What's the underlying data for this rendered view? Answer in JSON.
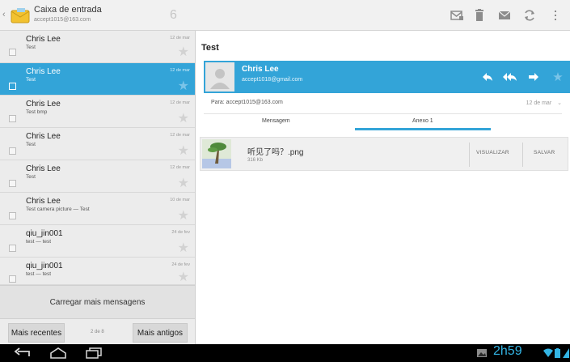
{
  "header": {
    "back_glyph": "‹",
    "inbox_title": "Caixa de entrada",
    "account": "accept1015@163.com",
    "unread_count": "6",
    "icons": [
      "mark-unread-icon",
      "delete-icon",
      "move-icon",
      "refresh-icon",
      "overflow-menu-icon"
    ]
  },
  "messages": [
    {
      "from": "Chris Lee",
      "subject": "Test",
      "date": "12 de mar",
      "selected": false
    },
    {
      "from": "Chris Lee",
      "subject": "Test",
      "date": "12 de mar",
      "selected": true
    },
    {
      "from": "Chris Lee",
      "subject": "Test bmp",
      "date": "12 de mar",
      "selected": false
    },
    {
      "from": "Chris Lee",
      "subject": "Test",
      "date": "12 de mar",
      "selected": false
    },
    {
      "from": "Chris Lee",
      "subject": "Test",
      "date": "12 de mar",
      "selected": false
    },
    {
      "from": "Chris Lee",
      "subject": "Test camera picture — Test",
      "date": "10 de mar",
      "selected": false
    },
    {
      "from": "qiu_jin001",
      "subject": "test — test",
      "date": "24 de fev",
      "selected": false
    },
    {
      "from": "qiu_jin001",
      "subject": "test — test",
      "date": "24 de fev",
      "selected": false
    }
  ],
  "list_footer": {
    "load_more": "Carregar mais mensagens",
    "newer_button": "Mais recentes",
    "page_indicator": "2 de 8",
    "older_button": "Mais antigos"
  },
  "reader": {
    "subject": "Test",
    "sender_name": "Chris Lee",
    "sender_email": "accept1018@gmail.com",
    "to_line": "Para: accept1015@163.com",
    "date": "12 de mar",
    "tab_message": "Mensagem",
    "tab_attachment": "Anexo 1",
    "attachment_name": "听见了吗？.png",
    "attachment_size": "316 Kb",
    "view_button": "VISUALIZAR",
    "save_button": "SALVAR"
  },
  "system_bar": {
    "clock": "2h59"
  },
  "colors": {
    "accent": "#33a4d8",
    "clock": "#33b5e5"
  }
}
